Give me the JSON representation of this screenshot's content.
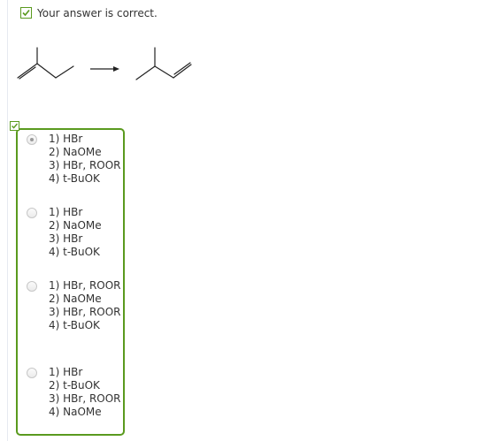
{
  "feedback": {
    "message": "Your answer is correct.",
    "accent_color": "#5a9a1e",
    "icon": "check-icon"
  },
  "reaction": {
    "starting_material": "2-methyl-1-butene",
    "product": "3-methyl-1-butene",
    "arrow": "reaction-arrow"
  },
  "answer_options": [
    {
      "selected": true,
      "steps": [
        "1) HBr",
        "2) NaOMe",
        "3) HBr, ROOR",
        "4) t-BuOK"
      ]
    },
    {
      "selected": false,
      "steps": [
        "1) HBr",
        "2) NaOMe",
        "3) HBr",
        "4) t-BuOK"
      ]
    },
    {
      "selected": false,
      "steps": [
        "1) HBr, ROOR",
        "2) NaOMe",
        "3) HBr, ROOR",
        "4) t-BuOK"
      ]
    },
    {
      "selected": false,
      "steps": [
        "1) HBr",
        "2) t-BuOK",
        "3) HBr, ROOR",
        "4) NaOMe"
      ]
    }
  ]
}
